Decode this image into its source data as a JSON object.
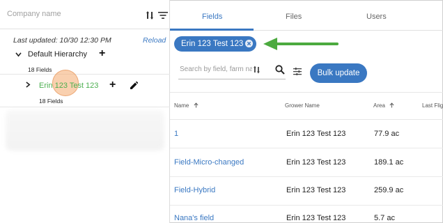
{
  "sidebar": {
    "company_placeholder": "Company name",
    "last_updated": "Last updated: 10/30 12:30 PM",
    "reload_label": "Reload",
    "tree": [
      {
        "label": "Default Hierarchy",
        "count": "18 Fields",
        "expanded": true
      },
      {
        "label": "Erin 123 Test 123",
        "count": "18 Fields",
        "expanded": false,
        "color": "#4caf50"
      }
    ]
  },
  "tabs": [
    {
      "label": "Fields",
      "active": true
    },
    {
      "label": "Files",
      "active": false
    },
    {
      "label": "Users",
      "active": false
    }
  ],
  "filter_chip": {
    "label": "Erin 123 Test 123"
  },
  "search": {
    "placeholder": "Search by field, farm name, #"
  },
  "toolbar": {
    "bulk_update_label": "Bulk update"
  },
  "table": {
    "columns": [
      "Name",
      "Grower Name",
      "Area",
      "Last Flig"
    ],
    "rows": [
      {
        "name": "1",
        "grower": "Erin 123 Test 123",
        "area": "77.9 ac"
      },
      {
        "name": "Field-Micro-changed",
        "grower": "Erin 123 Test 123",
        "area": "189.1 ac"
      },
      {
        "name": "Field-Hybrid",
        "grower": "Erin 123 Test 123",
        "area": "259.9 ac"
      },
      {
        "name": "Nana's field",
        "grower": "Erin 123 Test 123",
        "area": "5.7 ac"
      }
    ]
  },
  "colors": {
    "accent": "#3a78c2",
    "selected_tree_text": "#4caf50",
    "annotation_arrow": "#4caa3f"
  }
}
